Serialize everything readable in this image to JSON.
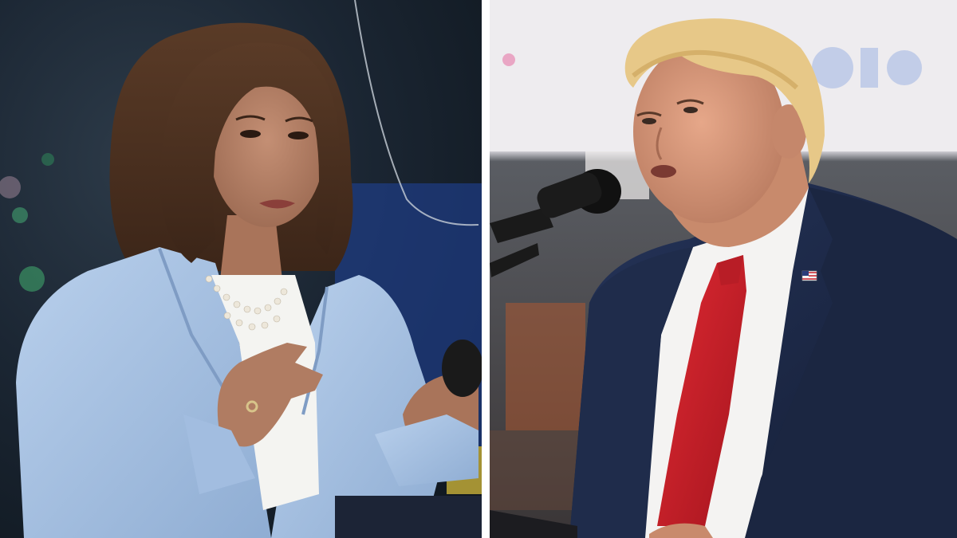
{
  "image": {
    "layout": "side-by-side",
    "panels": [
      {
        "subject": "speaker-left",
        "suit_color": "#a9c3e3",
        "background_color": "#1c2a3a"
      },
      {
        "subject": "speaker-right",
        "suit_color": "#1d2a48",
        "tie_color": "#c8202a",
        "background_color": "#c9c9cf"
      }
    ],
    "divider_color": "#ffffff"
  }
}
